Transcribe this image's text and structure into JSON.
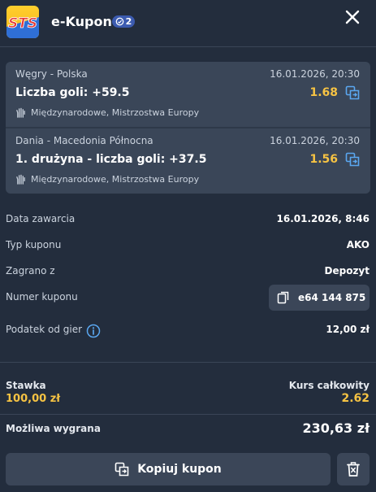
{
  "header": {
    "logo_text": "STS",
    "title": "e-Kupon",
    "badge_count": "2"
  },
  "selections": [
    {
      "event": "Węgry - Polska",
      "date": "16.01.2026, 20:30",
      "market": "Liczba goli: +59.5",
      "odds": "1.68",
      "league": "Międzynarodowe, Mistrzostwa Europy"
    },
    {
      "event": "Dania - Macedonia Północna",
      "date": "16.01.2026, 20:30",
      "market": "1. drużyna - liczba goli: +37.5",
      "odds": "1.56",
      "league": "Międzynarodowe, Mistrzostwa Europy"
    }
  ],
  "details": {
    "date_label": "Data zawarcia",
    "date_value": "16.01.2026, 8:46",
    "type_label": "Typ kuponu",
    "type_value": "AKO",
    "played_label": "Zagrano z",
    "played_value": "Depozyt",
    "number_label": "Numer kuponu",
    "number_value": "e64 144 875",
    "tax_label": "Podatek od gier",
    "tax_value": "12,00 zł"
  },
  "summary": {
    "stake_label": "Stawka",
    "stake_value": "100,00 zł",
    "total_odds_label": "Kurs całkowity",
    "total_odds_value": "2.62",
    "win_label": "Możliwa wygrana",
    "win_value": "230,63 zł"
  },
  "actions": {
    "copy_label": "Kopiuj kupon"
  },
  "colors": {
    "background": "#232d3d",
    "card": "#3a4658",
    "accent_yellow": "#f6c343",
    "badge_blue": "#3c5bb0",
    "icon_blue": "#5aa7f0"
  },
  "icons": {
    "logo": "sts-logo",
    "badge": "coupon-icon",
    "close": "close-icon",
    "swap": "swap-icon",
    "league": "handball-icon",
    "copy_number": "copy-icon",
    "info": "info-icon",
    "copy_coupon": "copy-coupon-icon",
    "delete": "trash-icon"
  }
}
